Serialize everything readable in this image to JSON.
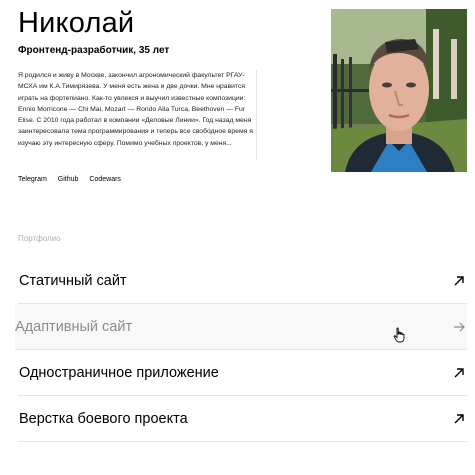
{
  "profile": {
    "name": "Николай",
    "subtitle": "Фронтенд-разработчик, 35 лет",
    "bio": "Я родился и живу в Москве, закончил агрономический факультет РГАУ-МСХА им К.А.Тимирязева. У меня есть жена и две дочки. Мне нравится играть на фортепиано. Как-то увлекся и выучил известные композиции: Ennio Morricone — Chi Mai, Mozart — Rondo Alla Turca, Beethoven — Fur Elise. С 2010 года работал в компании «Деловые Линии». Год назад меня заинтересовала тема программирования и теперь все свободное время я изучаю эту интересную сферу. Помимо учебных проектов, у меня...",
    "links": [
      "Telegram",
      "Github",
      "Codewars"
    ]
  },
  "portfolio": {
    "label": "Портфолио",
    "items": [
      {
        "label": "Статичный сайт",
        "icon": "arrow-up-right-icon"
      },
      {
        "label": "Адаптивный сайт",
        "icon": "arrow-right-icon",
        "state": "hover"
      },
      {
        "label": "Одностраничное приложение",
        "icon": "arrow-up-right-icon"
      },
      {
        "label": "Верстка боевого проекта",
        "icon": "arrow-up-right-icon"
      }
    ]
  },
  "colors": {
    "text": "#000000",
    "muted": "#b0b0b0",
    "hover_text": "#8c8c8c",
    "divider": "#e6e6e6",
    "hover_bg": "#f8f8f8"
  }
}
